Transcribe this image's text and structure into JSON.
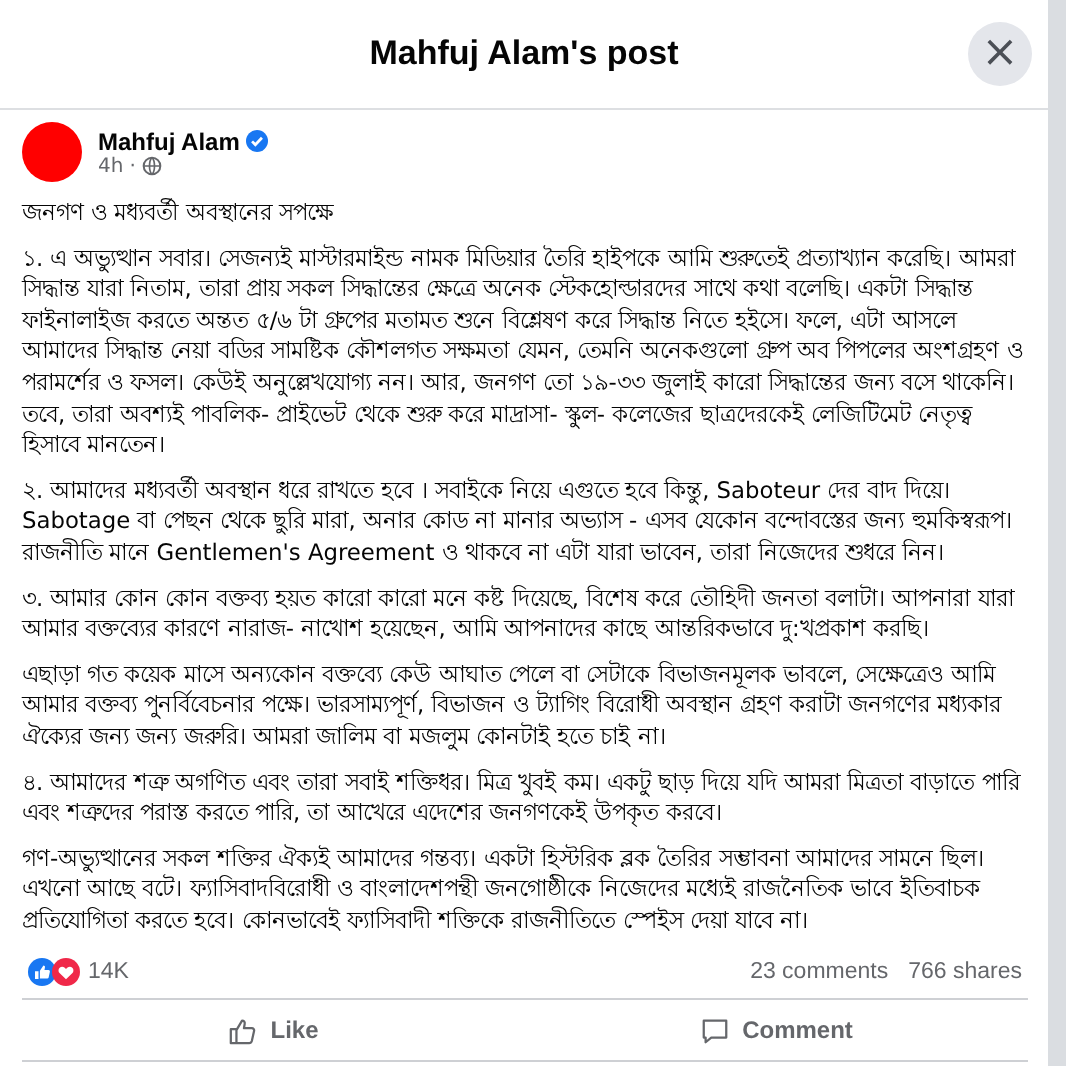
{
  "dialog": {
    "title": "Mahfuj Alam's post",
    "close_label": "×"
  },
  "post": {
    "author": "Mahfuj Alam",
    "verified": true,
    "time": "4h",
    "separator": "·",
    "public": true,
    "paragraphs": [
      "জনগণ ও মধ্যবর্তী অবস্থানের সপক্ষে",
      "১.  এ অভ্যুত্থান সবার। সেজন্যই মাস্টারমাইন্ড নামক মিডিয়ার তৈরি হাইপকে আমি শুরুতেই প্রত্যাখ্যান করেছি। আমরা সিদ্ধান্ত যারা নিতাম, তারা প্রায় সকল সিদ্ধান্তের ক্ষেত্রে অনেক স্টেকহোল্ডারদের সাথে কথা বলেছি। একটা সিদ্ধান্ত ফাইনালাইজ করতে অন্তত ৫/৬ টা গ্রুপের মতামত শুনে বিশ্লেষণ করে সিদ্ধান্ত নিতে হইসে। ফলে, এটা আসলে আমাদের সিদ্ধান্ত নেয়া বডির সামষ্টিক কৌশলগত সক্ষমতা যেমন, তেমনি অনেকগুলো গ্রুপ অব পিপলের অংশগ্রহণ ও পরামর্শের ও ফসল। কেউই অনুল্লেখযোগ্য নন। আর, জনগণ তো ১৯-৩৩ জুলাই কারো সিদ্ধান্তের জন্য বসে থাকেনি।  তবে, তারা অবশ্যই  পাবলিক- প্রাইভেট থেকে শুরু করে মাদ্রাসা- স্কুল- কলেজের ছাত্রদেরকেই লেজিটিমেট নেতৃত্ব হিসাবে মানতেন।",
      "২. আমাদের মধ্যবর্তী অবস্থান ধরে রাখতে হবে । সবাইকে নিয়ে এগুতে হবে কিন্তু, Saboteur দের বাদ দিয়ে। Sabotage বা পেছন থেকে ছুরি মারা, অনার কোড না মানার অভ্যাস - এসব যেকোন বন্দোবস্তের জন্য হুমকিস্বরূপ। রাজনীতি মানে Gentlemen's Agreement ও থাকবে না এটা যারা ভাবেন, তারা নিজেদের শুধরে নিন।",
      "৩. আমার কোন কোন বক্তব্য হয়ত কারো কারো মনে কষ্ট দিয়েছে, বিশেষ করে তৌহিদী জনতা বলাটা। আপনারা যারা আমার বক্তব্যের কারণে নারাজ- নাখোশ হয়েছেন,  আমি আপনাদের কাছে আন্তরিকভাবে দু:খপ্রকাশ করছি।",
      "এছাড়া গত কয়েক মাসে অন্যকোন বক্তব্যে কেউ আঘাত পেলে বা সেটাকে বিভাজনমূলক ভাবলে, সেক্ষেত্রেও আমি আমার বক্তব্য পুনর্বিবেচনার পক্ষে। ভারসাম্যপূর্ণ, বিভাজন ও ট্যাগিং বিরোধী অবস্থান গ্রহণ করাটা জনগণের মধ্যকার ঐক্যের জন্য জন্য জরুরি। আমরা জালিম বা মজলুম কোনটাই হতে চাই না।",
      "৪. আমাদের শত্রু অগণিত এবং তারা সবাই শক্তিধর। মিত্র খুবই কম। একটু ছাড় দিয়ে যদি আমরা মিত্রতা বাড়াতে পারি এবং শত্রুদের পরাস্ত করতে পারি, তা আখেরে এদেশের জনগণকেই উপকৃত করবে।",
      "গণ-অভ্যুত্থানের সকল শক্তির ঐক্যই আমাদের গন্তব্য। একটা হিস্টরিক ব্লক তৈরির সম্ভাবনা আমাদের সামনে ছিল। এখনো আছে বটে।  ফ্যাসিবাদবিরোধী ও বাংলাদেশপন্থী জনগোষ্ঠীকে নিজেদের মধ্যেই রাজনৈতিক ভাবে ইতিবাচক প্রতিযোগিতা করতে হবে। কোনভাবেই ফ্যাসিবাদী শক্তিকে রাজনীতিতে স্পেইস দেয়া যাবে না।"
    ],
    "reactions": {
      "types": [
        {
          "kind": "like"
        },
        {
          "kind": "love"
        }
      ],
      "count": "14K"
    },
    "comments": "23 comments",
    "shares": "766 shares",
    "actions": [
      {
        "kind": "like",
        "label": "Like"
      },
      {
        "kind": "comment",
        "label": "Comment"
      }
    ]
  }
}
